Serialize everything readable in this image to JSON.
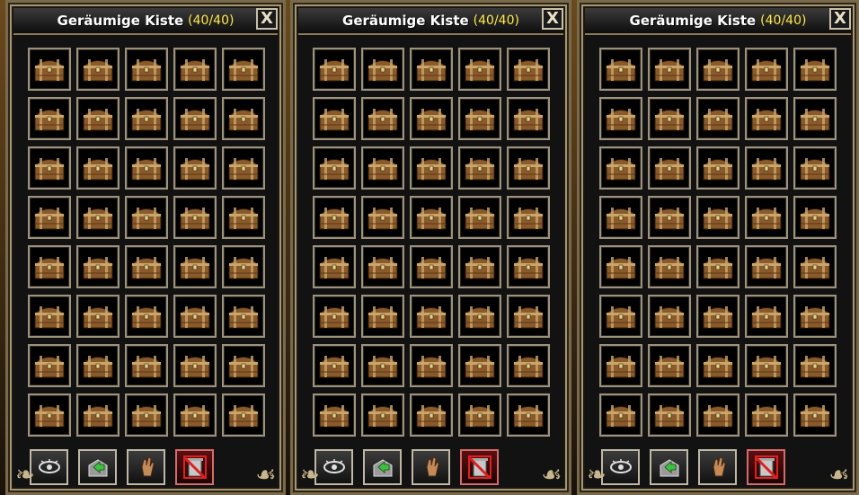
{
  "windows": [
    {
      "title": "Geräumige Kiste",
      "count": "(40/40)",
      "close_glyph": "X",
      "slots": [
        "chest-item",
        "chest-item",
        "chest-item",
        "chest-item",
        "chest-item",
        "chest-item",
        "chest-item",
        "chest-item",
        "chest-item",
        "chest-item",
        "chest-item",
        "chest-item",
        "chest-item",
        "chest-item",
        "chest-item",
        "chest-item",
        "chest-item",
        "chest-item",
        "chest-item",
        "chest-item",
        "chest-item",
        "chest-item",
        "chest-item",
        "chest-item",
        "chest-item",
        "chest-item",
        "chest-item",
        "chest-item",
        "chest-item",
        "chest-item",
        "chest-item",
        "chest-item",
        "chest-item",
        "chest-item",
        "chest-item",
        "chest-item",
        "chest-item",
        "chest-item",
        "chest-item",
        "chest-item"
      ],
      "tools": [
        "eye-icon",
        "sort-arrow-icon",
        "hand-icon",
        "no-trash-icon"
      ]
    },
    {
      "title": "Geräumige Kiste",
      "count": "(40/40)",
      "close_glyph": "X",
      "slots": [
        "chest-item",
        "chest-item",
        "chest-item",
        "chest-item",
        "chest-item",
        "chest-item",
        "chest-item",
        "chest-item",
        "chest-item",
        "chest-item",
        "chest-item",
        "chest-item",
        "chest-item",
        "chest-item",
        "chest-item",
        "chest-item",
        "chest-item",
        "chest-item",
        "chest-item",
        "chest-item",
        "chest-item",
        "chest-item",
        "chest-item",
        "chest-item",
        "chest-item",
        "chest-item",
        "chest-item",
        "chest-item",
        "chest-item",
        "chest-item",
        "chest-item",
        "chest-item",
        "chest-item",
        "chest-item",
        "chest-item",
        "chest-item",
        "chest-item",
        "chest-item",
        "chest-item",
        "chest-item"
      ],
      "tools": [
        "eye-icon",
        "sort-arrow-icon",
        "hand-icon",
        "no-trash-icon"
      ]
    },
    {
      "title": "Geräumige Kiste",
      "count": "(40/40)",
      "close_glyph": "X",
      "slots": [
        "chest-item",
        "chest-item",
        "chest-item",
        "chest-item",
        "chest-item",
        "chest-item",
        "chest-item",
        "chest-item",
        "chest-item",
        "chest-item",
        "chest-item",
        "chest-item",
        "chest-item",
        "chest-item",
        "chest-item",
        "chest-item",
        "chest-item",
        "chest-item",
        "chest-item",
        "chest-item",
        "chest-item",
        "chest-item",
        "chest-item",
        "chest-item",
        "chest-item",
        "chest-item",
        "chest-item",
        "chest-item",
        "chest-item",
        "chest-item",
        "chest-item",
        "chest-item",
        "chest-item",
        "chest-item",
        "chest-item",
        "chest-item",
        "chest-item",
        "chest-item",
        "chest-item",
        "chest-item"
      ],
      "tools": [
        "eye-icon",
        "sort-arrow-icon",
        "hand-icon",
        "no-trash-icon"
      ]
    }
  ],
  "colors": {
    "title_text": "#ffffff",
    "count_text": "#ffe84a",
    "slot_border": "#9d927c",
    "window_bg": "#121212",
    "chest_wood": "#8a5a2b",
    "chest_band": "#c9a66b"
  }
}
